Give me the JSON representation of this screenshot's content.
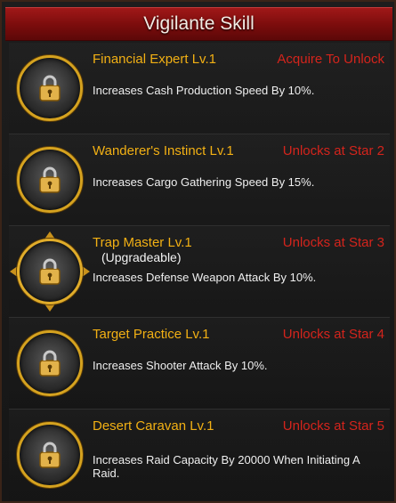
{
  "header": {
    "title": "Vigilante Skill"
  },
  "skills": [
    {
      "name": "Financial Expert Lv.1",
      "subtitle": "",
      "status": "Acquire To Unlock",
      "description": "Increases Cash Production Speed By 10%.",
      "icon": "cash-lock-icon"
    },
    {
      "name": "Wanderer's Instinct Lv.1",
      "subtitle": "",
      "status": "Unlocks at Star 2",
      "description": "Increases Cargo Gathering Speed By 15%.",
      "icon": "truck-lock-icon"
    },
    {
      "name": "Trap Master Lv.1",
      "subtitle": "(Upgradeable)",
      "status": "Unlocks at Star 3",
      "description": "Increases Defense Weapon Attack By 10%.",
      "icon": "trap-lock-icon"
    },
    {
      "name": "Target Practice Lv.1",
      "subtitle": "",
      "status": "Unlocks at Star 4",
      "description": "Increases Shooter Attack By 10%.",
      "icon": "rifle-lock-icon"
    },
    {
      "name": "Desert Caravan Lv.1",
      "subtitle": "",
      "status": "Unlocks at Star 5",
      "description": "Increases Raid Capacity By 20000 When Initiating A Raid.",
      "icon": "caravan-lock-icon"
    }
  ],
  "colors": {
    "header_red": "#8e1212",
    "name_gold": "#f2b014",
    "status_red": "#d4241c",
    "ring_gold": "#d5a21f"
  }
}
